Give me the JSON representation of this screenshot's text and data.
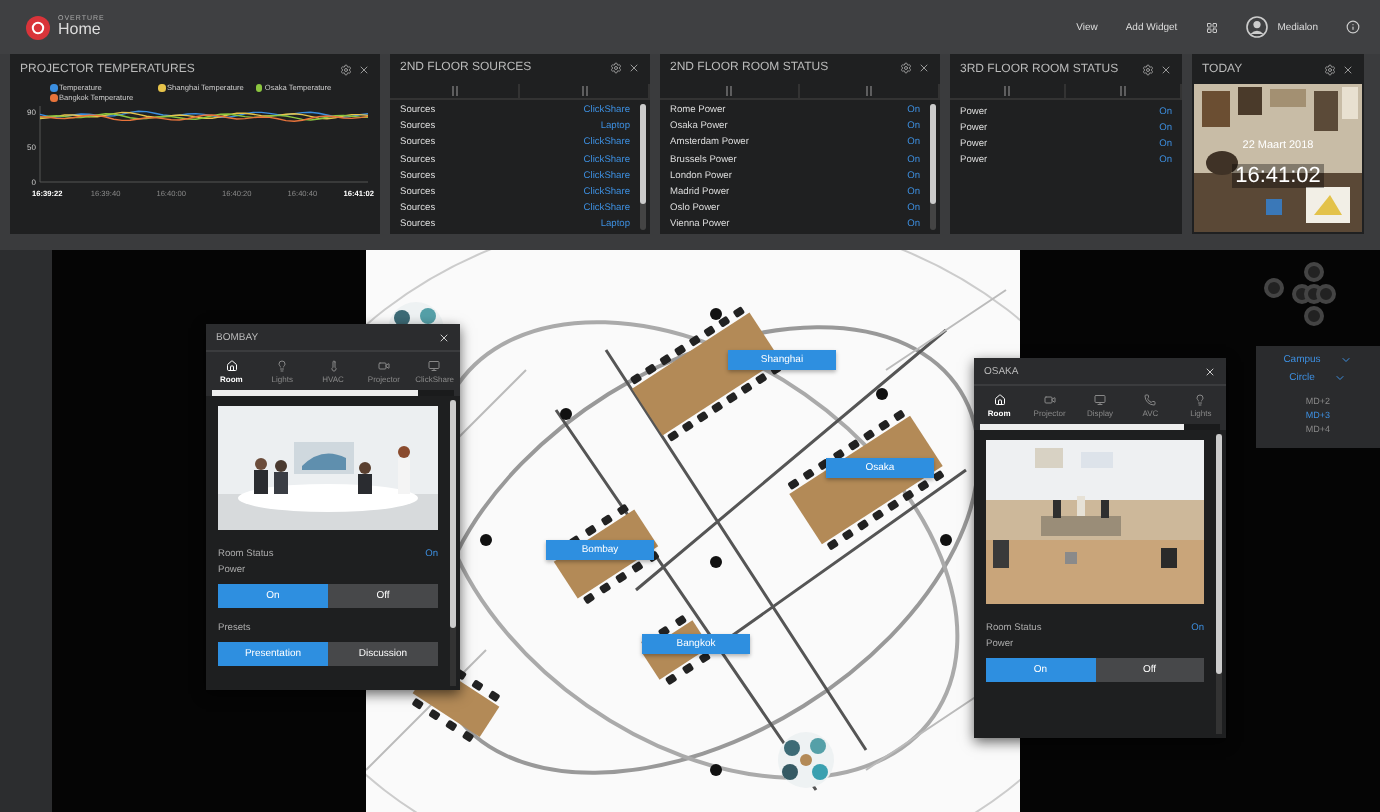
{
  "top_bar": {
    "brand": "OVERTURE",
    "title": "Home",
    "actions": [
      "View",
      "Add Widget"
    ],
    "user": "Medialon"
  },
  "widgets": [
    {
      "kind": "chart",
      "title": "PROJECTOR TEMPERATURES",
      "legend": [
        {
          "label": "Temperature",
          "color": "#3b8ee0"
        },
        {
          "label": "Shanghai Temperature",
          "color": "#e6c34a"
        },
        {
          "label": "Osaka Temperature",
          "color": "#8cc63f"
        },
        {
          "label": "Bangkok Temperature",
          "color": "#e8743b"
        }
      ],
      "y_labels": [
        "90",
        "50",
        "0"
      ],
      "x_labels": [
        "16:39:22",
        "16:39:40",
        "16:40:00",
        "16:40:20",
        "16:40:40",
        "16:41:02"
      ]
    },
    {
      "kind": "table",
      "title": "2ND FLOOR SOURCES",
      "rows": [
        {
          "name": "Sources",
          "value": "ClickShare"
        },
        {
          "name": "Sources",
          "value": "Laptop"
        },
        {
          "name": "Sources",
          "value": "ClickShare"
        },
        {
          "name": "Sources",
          "value": "ClickShare"
        },
        {
          "name": "Sources",
          "value": "ClickShare"
        },
        {
          "name": "Sources",
          "value": "ClickShare"
        },
        {
          "name": "Sources",
          "value": "ClickShare"
        },
        {
          "name": "Sources",
          "value": "Laptop"
        }
      ]
    },
    {
      "kind": "table",
      "title": "2ND FLOOR ROOM STATUS",
      "rows": [
        {
          "name": "Rome Power",
          "value": "On"
        },
        {
          "name": "Osaka Power",
          "value": "On"
        },
        {
          "name": "Amsterdam Power",
          "value": "On"
        },
        {
          "name": "Brussels Power",
          "value": "On"
        },
        {
          "name": "London Power",
          "value": "On"
        },
        {
          "name": "Madrid Power",
          "value": "On"
        },
        {
          "name": "Oslo Power",
          "value": "On"
        },
        {
          "name": "Vienna Power",
          "value": "On"
        }
      ]
    },
    {
      "kind": "table",
      "title": "3RD FLOOR ROOM STATUS",
      "rows": [
        {
          "name": "Power",
          "value": "On"
        },
        {
          "name": "Power",
          "value": "On"
        },
        {
          "name": "Power",
          "value": "On"
        },
        {
          "name": "Power",
          "value": "On"
        }
      ]
    },
    {
      "kind": "clock",
      "title": "TODAY",
      "date": "22 Maart 2018",
      "time": "16:41:02"
    }
  ],
  "floor_plan": {
    "rooms": [
      {
        "label": "Shanghai"
      },
      {
        "label": "Osaka"
      },
      {
        "label": "Bombay"
      },
      {
        "label": "Bangkok"
      }
    ]
  },
  "room_panels": [
    {
      "title": "BOMBAY",
      "tabs": [
        {
          "label": "Room",
          "selected": true
        },
        {
          "label": "Lights",
          "selected": false
        },
        {
          "label": "HVAC",
          "selected": false
        },
        {
          "label": "Projector",
          "selected": false
        },
        {
          "label": "ClickShare",
          "selected": false
        }
      ],
      "status_label": "Room Status",
      "status_value": "On",
      "power_label": "Power",
      "power_options": [
        {
          "label": "On",
          "selected": true
        },
        {
          "label": "Off",
          "selected": false
        }
      ],
      "presets_label": "Presets",
      "presets": [
        {
          "label": "Presentation",
          "selected": true
        },
        {
          "label": "Discussion",
          "selected": false
        }
      ]
    },
    {
      "title": "OSAKA",
      "tabs": [
        {
          "label": "Room",
          "selected": true
        },
        {
          "label": "Projector",
          "selected": false
        },
        {
          "label": "Display",
          "selected": false
        },
        {
          "label": "AVC",
          "selected": false
        },
        {
          "label": "Lights",
          "selected": false
        }
      ],
      "status_label": "Room Status",
      "status_value": "On",
      "power_label": "Power",
      "power_options": [
        {
          "label": "On",
          "selected": true
        },
        {
          "label": "Off",
          "selected": false
        }
      ]
    }
  ],
  "map_controls": {
    "filters": [
      {
        "label": "Campus"
      },
      {
        "label": "Circle"
      }
    ],
    "floors": [
      {
        "label": "MD+2",
        "selected": false
      },
      {
        "label": "MD+3",
        "selected": true
      },
      {
        "label": "MD+4",
        "selected": false
      }
    ]
  }
}
